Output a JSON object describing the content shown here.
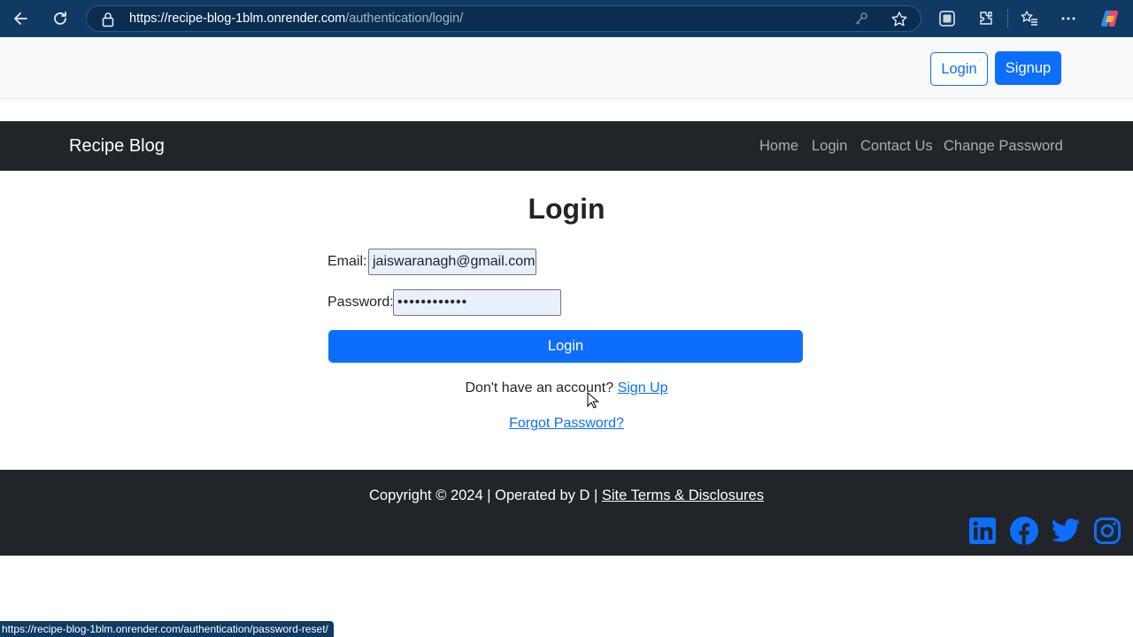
{
  "browser": {
    "url_host": "https://recipe-blog-1blm.onrender.com",
    "url_path": "/authentication/login/",
    "icons": [
      "back-arrow-icon",
      "reload-icon",
      "lock-icon",
      "key-icon",
      "star-icon",
      "screenshot-icon",
      "extensions-icon",
      "favorites-icon",
      "more-icon",
      "copilot-icon"
    ]
  },
  "top_auth": {
    "login_label": "Login",
    "signup_label": "Signup"
  },
  "navbar": {
    "brand": "Recipe Blog",
    "links": [
      "Home",
      "Login",
      "Contact Us",
      "Change Password"
    ]
  },
  "login_form": {
    "title": "Login",
    "email_label": "Email:",
    "email_value": "jaiswaranagh@gmail.com",
    "password_label": "Password:",
    "password_value": "••••••••••••",
    "submit_label": "Login",
    "signup_prompt": "Don't have an account?",
    "signup_link": "Sign Up",
    "forgot_link": "Forgot Password?"
  },
  "footer": {
    "copyright": "Copyright © 2024 | Operated by D |",
    "terms_link": "Site Terms & Disclosures",
    "social_icons": [
      "linkedin-icon",
      "facebook-icon",
      "twitter-icon",
      "instagram-icon"
    ]
  },
  "status_bar": {
    "hover_url": "https://recipe-blog-1blm.onrender.com/authentication/password-reset/"
  },
  "colors": {
    "primary": "#0d6efd",
    "dark": "#212529",
    "chrome": "#0f3a63"
  }
}
